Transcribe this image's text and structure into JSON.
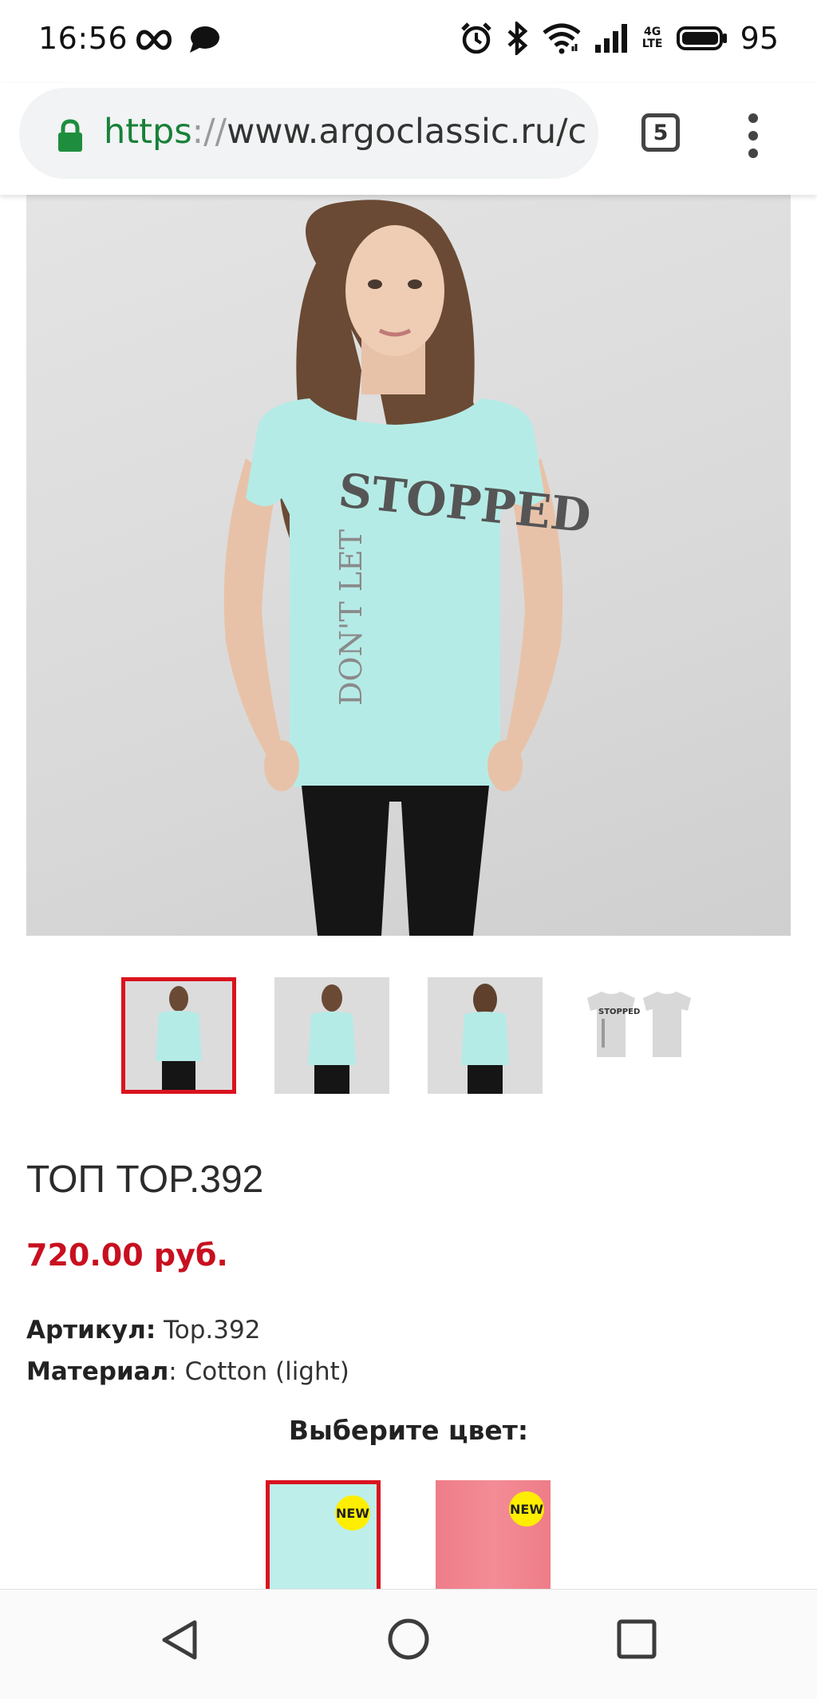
{
  "status_bar": {
    "time": "16:56",
    "battery_level": "95",
    "network_label": "4G LTE",
    "icons": [
      "infinity-icon",
      "chat-bubble-icon",
      "alarm-icon",
      "bluetooth-icon",
      "wifi-icon",
      "signal-icon",
      "battery-icon"
    ]
  },
  "browser": {
    "url_scheme": "https",
    "url_separator": "://",
    "url_host": "www.argoclassic.ru/c",
    "tab_count": "5",
    "colors": {
      "lock": "#1e8e3e",
      "scheme": "#188038"
    }
  },
  "product": {
    "title": "ТОП TOP.392",
    "price": "720.00 руб.",
    "article_label": "Артикул:",
    "article_value": "Top.392",
    "material_label": "Материал",
    "material_value": ": Cotton (light)",
    "shirt_print_top": "STOPPED",
    "shirt_print_side": "DON'T LET",
    "thumbnail_print": "STOPPED",
    "colors": {
      "price": "#c8101f",
      "selected_border": "#d9131e",
      "shirt_mint": "#b5ebe6"
    }
  },
  "color_picker": {
    "heading": "Выберите цвет:",
    "swatches": [
      {
        "badge": "NEW",
        "color": "#bdeeea",
        "selected": true
      },
      {
        "badge": "NEW",
        "color": "#f0838d",
        "selected": false
      }
    ]
  },
  "nav": {
    "icons": [
      "back-triangle-icon",
      "home-circle-icon",
      "recents-square-icon"
    ]
  }
}
